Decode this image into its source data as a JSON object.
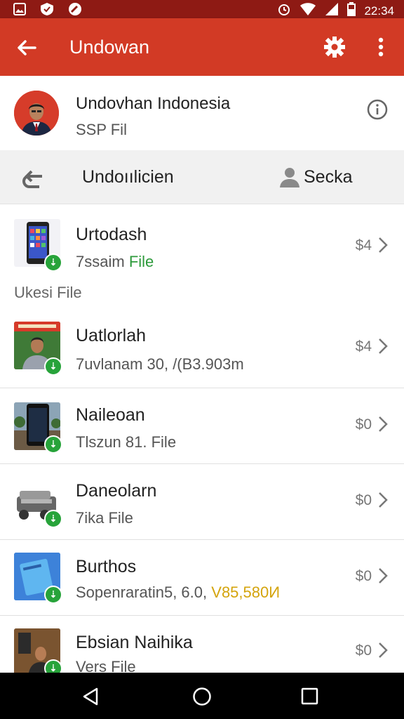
{
  "status_bar": {
    "time": "22:34",
    "left_icons": [
      "gallery-icon",
      "shield-icon",
      "edit-icon"
    ],
    "right_icons": [
      "alarm-icon",
      "wifi-icon",
      "signal-icon",
      "battery-icon"
    ]
  },
  "app_bar": {
    "title": "Undowan",
    "accent_color": "#d23a25",
    "back_icon": "arrow-back-icon",
    "settings_icon": "gear-icon",
    "more_icon": "more-vert-icon"
  },
  "profile": {
    "name": "Undovhan Indonesia",
    "subtitle": "SSP Fil",
    "info_icon": "info-icon"
  },
  "tabs": [
    {
      "label": "Undoıılicien",
      "icon": "redo-icon"
    },
    {
      "label": "Secka",
      "icon": "person-icon"
    }
  ],
  "section_label": "Ukesi File",
  "items": [
    {
      "title": "Urtodash",
      "subtitle_plain": "7ssaim",
      "subtitle_colored": "File",
      "subtitle_color": "green",
      "price": "$4",
      "thumb": "smartphone-thumb"
    },
    {
      "title": "Uatlorlah",
      "subtitle_plain": "7uvlanam 30, /(B3.903m",
      "subtitle_colored": "",
      "price": "$4",
      "thumb": "portrait-thumb"
    },
    {
      "title": "Naileoan",
      "subtitle_plain": "Tlszun 81. File",
      "subtitle_colored": "",
      "price": "$0",
      "thumb": "phone-street-thumb"
    },
    {
      "title": "Daneolarn",
      "subtitle_plain": "7ika File",
      "subtitle_colored": "",
      "price": "$0",
      "thumb": "machine-thumb"
    },
    {
      "title": "Burthos",
      "subtitle_plain": "Sopenraratin5, 6.0,",
      "subtitle_colored": "V85,580И",
      "subtitle_color": "yellow",
      "price": "$0",
      "thumb": "blue-book-thumb"
    },
    {
      "title": "Ebsian Naihika",
      "subtitle_plain": "Vers File",
      "subtitle_colored": "",
      "price": "$0",
      "thumb": "photo-thumb"
    }
  ],
  "nav_bar": {
    "back_icon": "nav-back-icon",
    "home_icon": "nav-home-icon",
    "recents_icon": "nav-recents-icon"
  }
}
